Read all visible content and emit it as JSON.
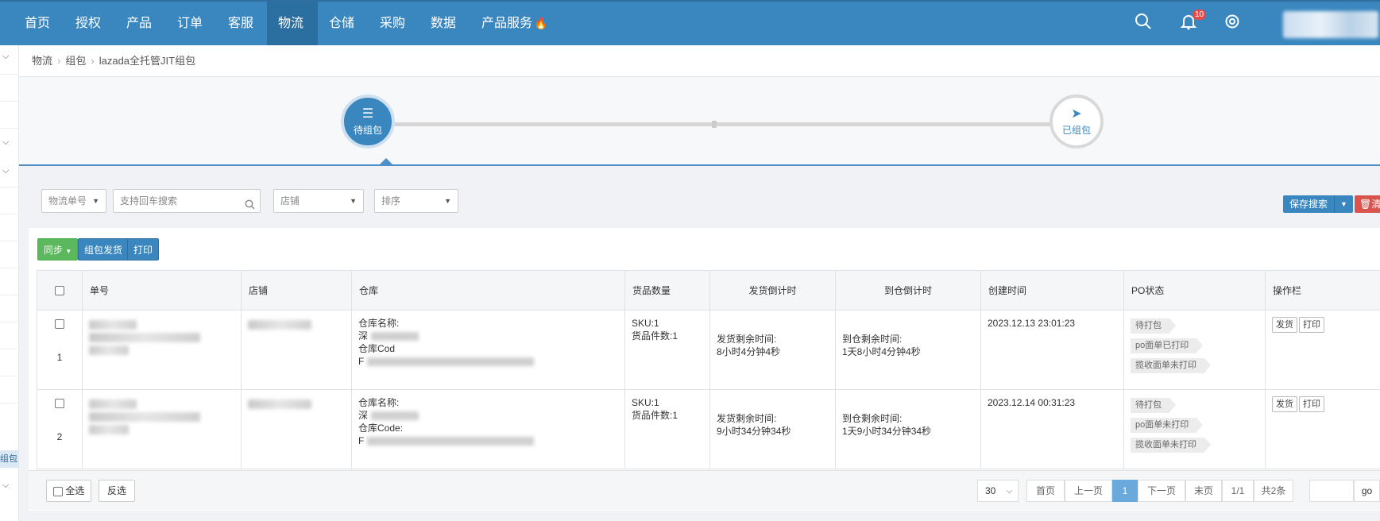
{
  "nav": {
    "items": [
      "首页",
      "授权",
      "产品",
      "订单",
      "客服",
      "物流",
      "仓储",
      "采购",
      "数据",
      "产品服务"
    ],
    "active": "物流",
    "notification_count": "10",
    "icons": [
      "search-icon",
      "bell-icon",
      "gear-icon",
      "fire-icon"
    ]
  },
  "sidebar": {
    "active_label": "组包"
  },
  "breadcrumb": [
    "物流",
    "组包",
    "lazada全托管JIT组包"
  ],
  "steps": [
    {
      "label": "待组包",
      "icon": "server-icon",
      "state": "active"
    },
    {
      "label": "已组包",
      "icon": "paper-plane-icon",
      "state": "inactive"
    }
  ],
  "filters": {
    "type_select": "物流单号",
    "search_placeholder": "支持回车搜索",
    "store_select": "店铺",
    "sort_select": "排序",
    "save_search": "保存搜索",
    "clear": "清"
  },
  "toolbar": {
    "sync": "同步",
    "pack_ship": "组包发货",
    "print": "打印"
  },
  "table": {
    "headers": [
      "单号",
      "店铺",
      "仓库",
      "货品数量",
      "发货倒计时",
      "到仓倒计时",
      "创建时间",
      "PO状态",
      "操作栏"
    ],
    "rows": [
      {
        "num": "1",
        "warehouse_name_label": "仓库名称:",
        "warehouse_prefix": "深",
        "warehouse_code_label": "仓库Cod",
        "warehouse_code_prefix": "F",
        "sku": "SKU:1",
        "pieces": "货品件数:1",
        "ship_label": "发货剩余时间:",
        "ship_value": "8小时4分钟4秒",
        "arrive_label": "到仓剩余时间:",
        "arrive_value": "1天8小时4分钟4秒",
        "created": "2023.12.13 23:01:23",
        "tags": [
          "待打包",
          "po面单已打印",
          "揽收面单未打印"
        ],
        "ops": [
          "发货",
          "打印"
        ]
      },
      {
        "num": "2",
        "warehouse_name_label": "仓库名称:",
        "warehouse_prefix": "深",
        "warehouse_code_label": "仓库Code:",
        "warehouse_code_prefix": "F",
        "sku": "SKU:1",
        "pieces": "货品件数:1",
        "ship_label": "发货剩余时间:",
        "ship_value": "9小时34分钟34秒",
        "arrive_label": "到仓剩余时间:",
        "arrive_value": "1天9小时34分钟34秒",
        "created": "2023.12.14 00:31:23",
        "tags": [
          "待打包",
          "po面单未打印",
          "揽收面单未打印"
        ],
        "ops": [
          "发货",
          "打印"
        ]
      }
    ]
  },
  "footer": {
    "select_all": "全选",
    "invert": "反选",
    "page_size": "30",
    "first": "首页",
    "prev": "上一页",
    "current": "1",
    "next": "下一页",
    "last": "末页",
    "page_info": "1/1",
    "total": "共2条",
    "go": "go"
  }
}
